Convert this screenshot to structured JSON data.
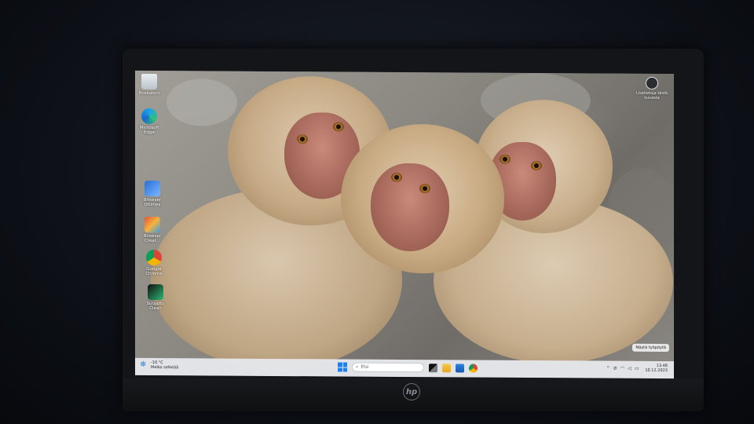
{
  "desktop": {
    "icons": [
      {
        "name": "recycle-bin",
        "label": "Roskakori"
      },
      {
        "name": "edge",
        "label": "Microsoft Edge"
      },
      {
        "name": "browser-utilities",
        "label": "Browser Utilities"
      },
      {
        "name": "browser-creator",
        "label": "Browser Creat..."
      },
      {
        "name": "chrome",
        "label": "Google Chrome"
      },
      {
        "name": "capcut",
        "label": "Suojattu Clean"
      }
    ],
    "corner_widget": {
      "label": "Lisätietoja tästä kuvasta",
      "icon": "camera-icon"
    },
    "toast": "Näytä työpöytä"
  },
  "taskbar": {
    "weather": {
      "temp": "-10 °C",
      "condition": "Melko selkeää",
      "icon": "snowflake-icon"
    },
    "search_placeholder": "Etsi",
    "apps": [
      "task-view-icon",
      "file-explorer-icon",
      "store-icon",
      "chrome-icon"
    ],
    "tray_icons": [
      "chevron-up-icon",
      "network-icon",
      "wifi-icon",
      "volume-icon",
      "battery-icon"
    ],
    "time": "13.48",
    "date": "10.12.2023"
  },
  "device": {
    "brand": "hp"
  },
  "colors": {
    "accent": "#1d7ff0",
    "taskbar": "#e6e8ec",
    "fur": "#c9b59c"
  }
}
